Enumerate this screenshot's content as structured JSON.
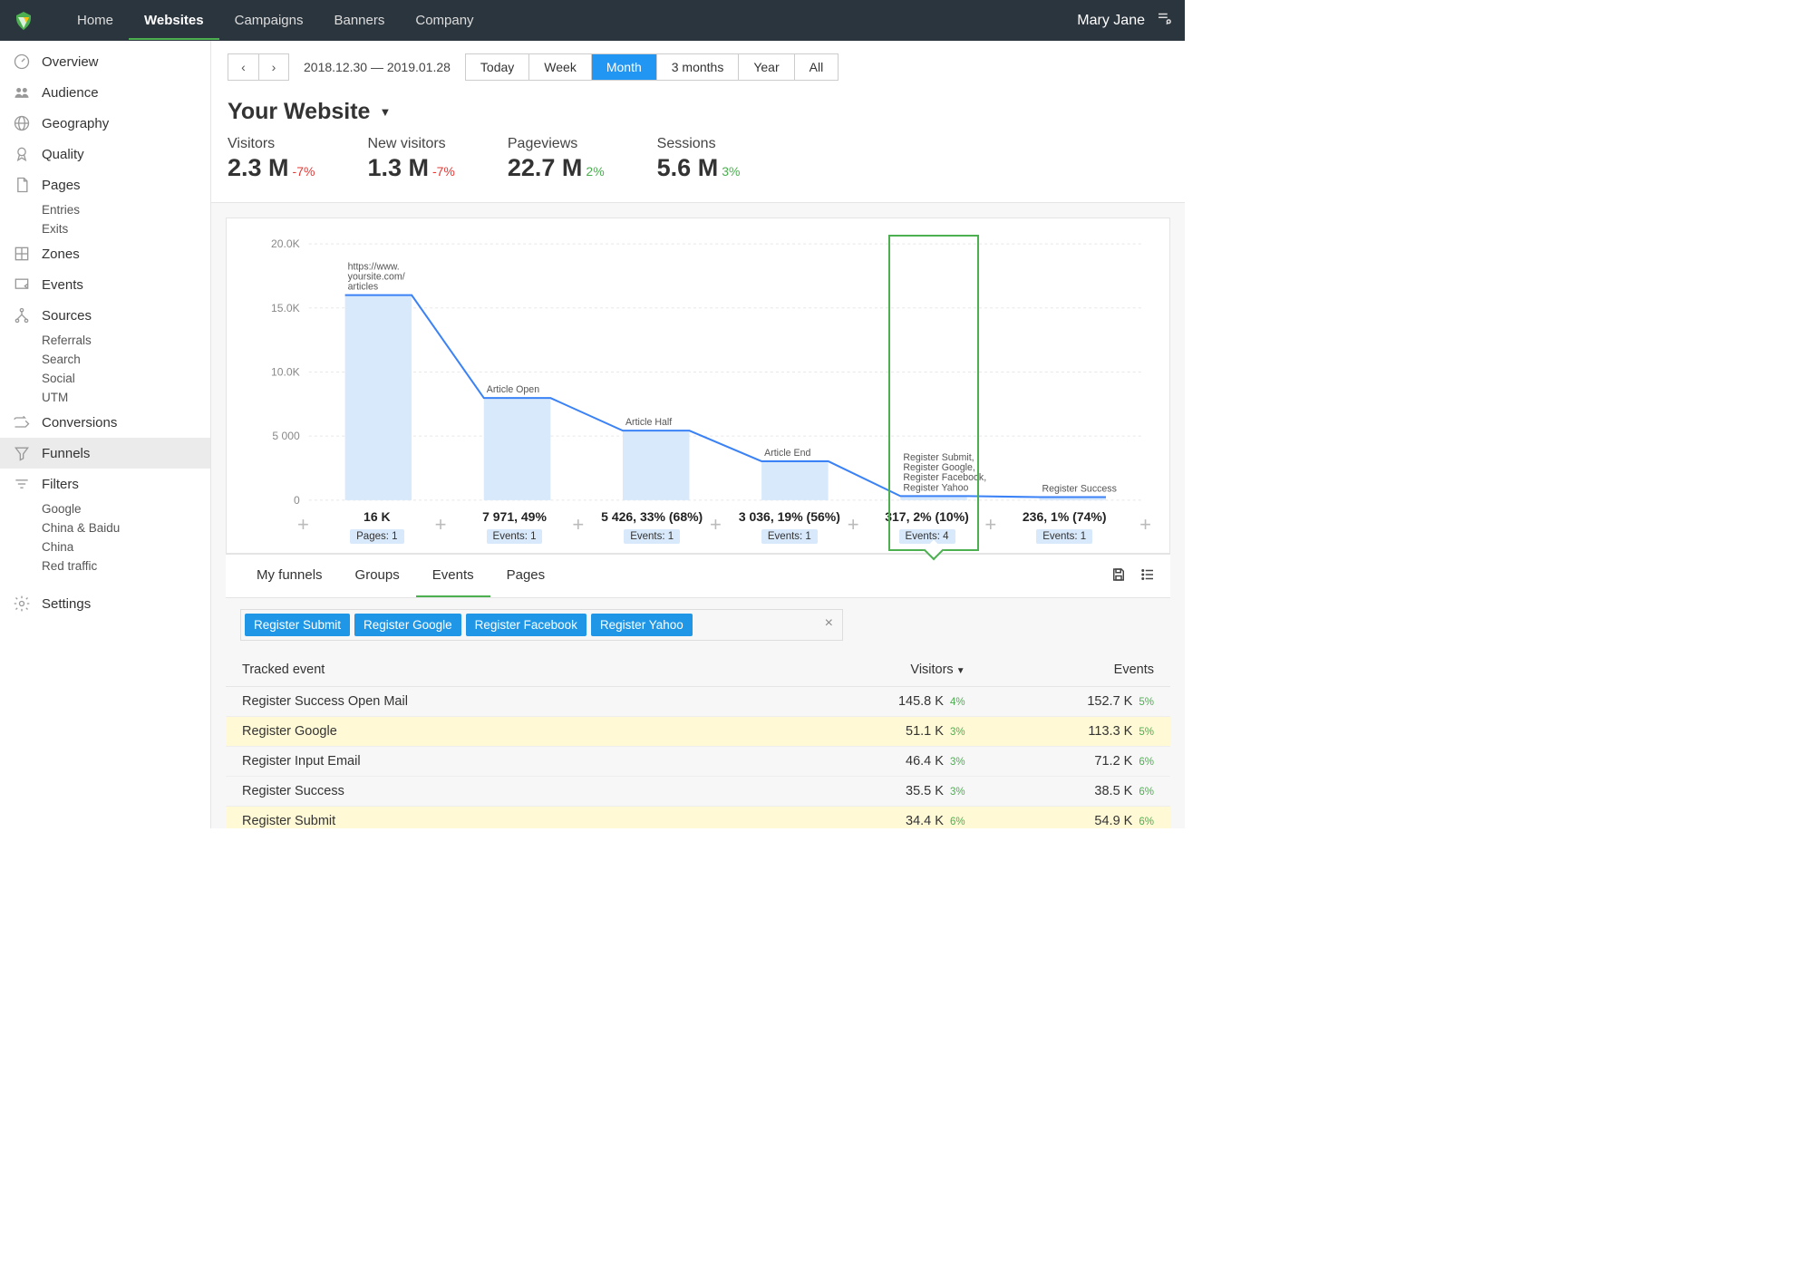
{
  "topbar": {
    "user": "Mary Jane",
    "nav": [
      "Home",
      "Websites",
      "Campaigns",
      "Banners",
      "Company"
    ],
    "active_nav": 1
  },
  "date": {
    "range_text": "2018.12.30  — 2019.01.28",
    "segments": [
      "Today",
      "Week",
      "Month",
      "3 months",
      "Year",
      "All"
    ],
    "active_segment": 2
  },
  "page_title": "Your Website",
  "kpi": [
    {
      "label": "Visitors",
      "value": "2.3 M",
      "delta": "-7%",
      "neg": true
    },
    {
      "label": "New visitors",
      "value": "1.3 M",
      "delta": "-7%",
      "neg": true
    },
    {
      "label": "Pageviews",
      "value": "22.7 M",
      "delta": "2%",
      "neg": false
    },
    {
      "label": "Sessions",
      "value": "5.6 M",
      "delta": "3%",
      "neg": false
    }
  ],
  "sidebar": {
    "items": [
      {
        "icon": "gauge",
        "label": "Overview"
      },
      {
        "icon": "users",
        "label": "Audience"
      },
      {
        "icon": "globe",
        "label": "Geography"
      },
      {
        "icon": "medal",
        "label": "Quality"
      },
      {
        "icon": "page",
        "label": "Pages",
        "subs": [
          "Entries",
          "Exits"
        ]
      },
      {
        "icon": "grid",
        "label": "Zones"
      },
      {
        "icon": "flag",
        "label": "Events"
      },
      {
        "icon": "fork",
        "label": "Sources",
        "subs": [
          "Referrals",
          "Search",
          "Social",
          "UTM"
        ]
      },
      {
        "icon": "arrow",
        "label": "Conversions"
      },
      {
        "icon": "funnel",
        "label": "Funnels",
        "active": true
      },
      {
        "icon": "filter",
        "label": "Filters",
        "subs": [
          "Google",
          "China & Baidu",
          "China",
          "Red traffic"
        ]
      },
      {
        "icon": "gear",
        "label": "Settings",
        "gap": true
      }
    ]
  },
  "tabs": {
    "items": [
      "My funnels",
      "Groups",
      "Events",
      "Pages"
    ],
    "active": 2
  },
  "event_filters": [
    "Register Submit",
    "Register Google",
    "Register Facebook",
    "Register Yahoo"
  ],
  "table": {
    "cols": [
      "Tracked event",
      "Visitors",
      "Events"
    ],
    "sort_col": 1,
    "rows": [
      {
        "name": "Register Success Open Mail",
        "visitors": "145.8 K",
        "vdelta": "4%",
        "events": "152.7 K",
        "edelta": "5%"
      },
      {
        "name": "Register Google",
        "visitors": "51.1 K",
        "vdelta": "3%",
        "events": "113.3 K",
        "edelta": "5%",
        "hl": true
      },
      {
        "name": "Register Input Email",
        "visitors": "46.4 K",
        "vdelta": "3%",
        "events": "71.2 K",
        "edelta": "6%"
      },
      {
        "name": "Register Success",
        "visitors": "35.5 K",
        "vdelta": "3%",
        "events": "38.5 K",
        "edelta": "6%"
      },
      {
        "name": "Register Submit",
        "visitors": "34.4 K",
        "vdelta": "6%",
        "events": "54.9 K",
        "edelta": "6%",
        "hl": true
      }
    ]
  },
  "chart_data": {
    "type": "bar",
    "ylabel_ticks": [
      "20.0K",
      "15.0K",
      "10.0K",
      "5 000",
      "0"
    ],
    "ylim": [
      0,
      20000
    ],
    "steps": [
      {
        "label": "https://www.\nyoursite.com/\narticles",
        "value": 16000,
        "stat": "16 K",
        "tag": "Pages: 1"
      },
      {
        "label": "Article Open",
        "value": 7971,
        "stat": "7 971, 49%",
        "tag": "Events: 1"
      },
      {
        "label": "Article Half",
        "value": 5426,
        "stat": "5 426, 33% (68%)",
        "tag": "Events: 1"
      },
      {
        "label": "Article End",
        "value": 3036,
        "stat": "3 036, 19% (56%)",
        "tag": "Events: 1"
      },
      {
        "label": "Register Submit,\nRegister Google,\nRegister Facebook,\nRegister Yahoo",
        "value": 317,
        "stat": "317, 2% (10%)",
        "tag": "Events: 4",
        "selected": true
      },
      {
        "label": "Register Success",
        "value": 236,
        "stat": "236, 1% (74%)",
        "tag": "Events: 1"
      }
    ]
  }
}
